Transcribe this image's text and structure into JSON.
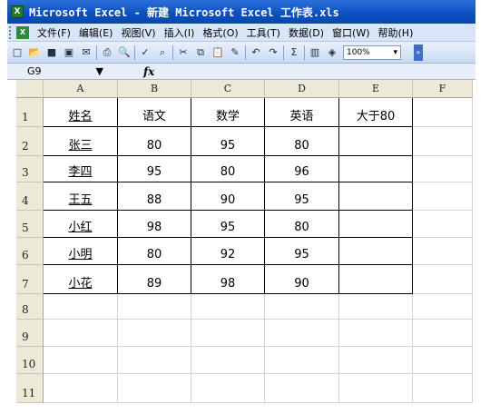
{
  "titlebar": {
    "icon": "excel-icon",
    "icon_glyph": "X",
    "title": "Microsoft Excel - 新建 Microsoft Excel 工作表.xls"
  },
  "menubar": {
    "items": [
      "文件(F)",
      "编辑(E)",
      "视图(V)",
      "插入(I)",
      "格式(O)",
      "工具(T)",
      "数据(D)",
      "窗口(W)",
      "帮助(H)"
    ]
  },
  "toolbar": {
    "zoom": "100%"
  },
  "formula_bar": {
    "cell_ref": "G9",
    "fx_label": "fx"
  },
  "grid": {
    "columns": [
      "A",
      "B",
      "C",
      "D",
      "E",
      "F"
    ],
    "rows": [
      "1",
      "2",
      "3",
      "4",
      "5",
      "6",
      "7",
      "8",
      "9",
      "10",
      "11"
    ],
    "cells": [
      [
        "姓名",
        "语文",
        "数学",
        "英语",
        "大于80",
        ""
      ],
      [
        "张三",
        "80",
        "95",
        "80",
        "",
        ""
      ],
      [
        "李四",
        "95",
        "80",
        "96",
        "",
        ""
      ],
      [
        "王五",
        "88",
        "90",
        "95",
        "",
        ""
      ],
      [
        "小红",
        "98",
        "95",
        "80",
        "",
        ""
      ],
      [
        "小明",
        "80",
        "92",
        "95",
        "",
        ""
      ],
      [
        "小花",
        "89",
        "98",
        "90",
        "",
        ""
      ],
      [
        "",
        "",
        "",
        "",
        "",
        ""
      ],
      [
        "",
        "",
        "",
        "",
        "",
        ""
      ],
      [
        "",
        "",
        "",
        "",
        "",
        ""
      ],
      [
        "",
        "",
        "",
        "",
        "",
        ""
      ]
    ]
  },
  "colors": {
    "titlebar": "#0a4fc0",
    "menubar": "#d8e4f8",
    "header": "#ece9d8"
  }
}
